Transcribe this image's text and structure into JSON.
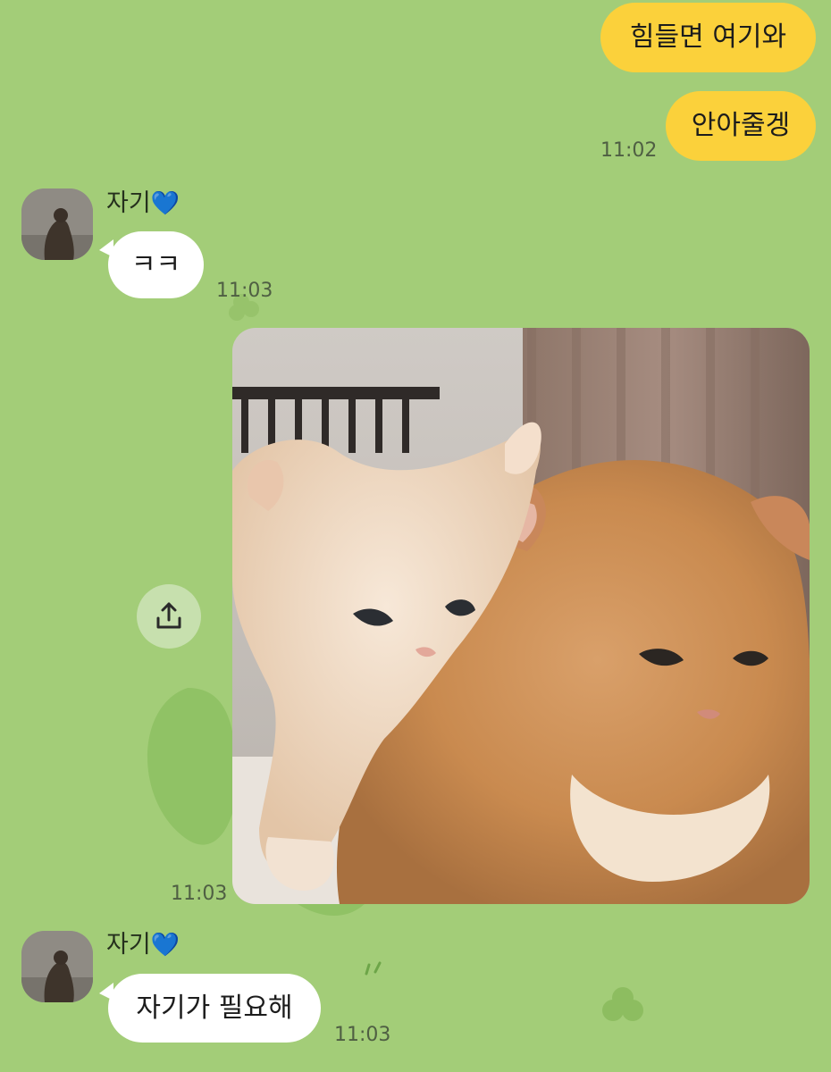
{
  "conversation": {
    "messages": [
      {
        "id": "m1",
        "from": "me",
        "text": "힘들면 여기와"
      },
      {
        "id": "m2",
        "from": "me",
        "text": "안아줄겡",
        "time": "11:02"
      },
      {
        "id": "m3",
        "from": "other",
        "sender": "자기",
        "sender_heart": "💙",
        "text": "ㅋㅋ",
        "time": "11:03"
      },
      {
        "id": "m4",
        "from": "me",
        "type": "image",
        "alt": "cats",
        "time": "11:03"
      },
      {
        "id": "m5",
        "from": "other",
        "sender": "자기",
        "sender_heart": "💙",
        "text": "자기가 필요해",
        "time": "11:03"
      }
    ]
  },
  "icons": {
    "share": "share-icon",
    "avatar": "avatar",
    "heart": "blue-heart-icon"
  },
  "colors": {
    "background": "#a3cd78",
    "my_bubble": "#fbd13b",
    "other_bubble": "#ffffff",
    "heart": "#2d85f5"
  }
}
